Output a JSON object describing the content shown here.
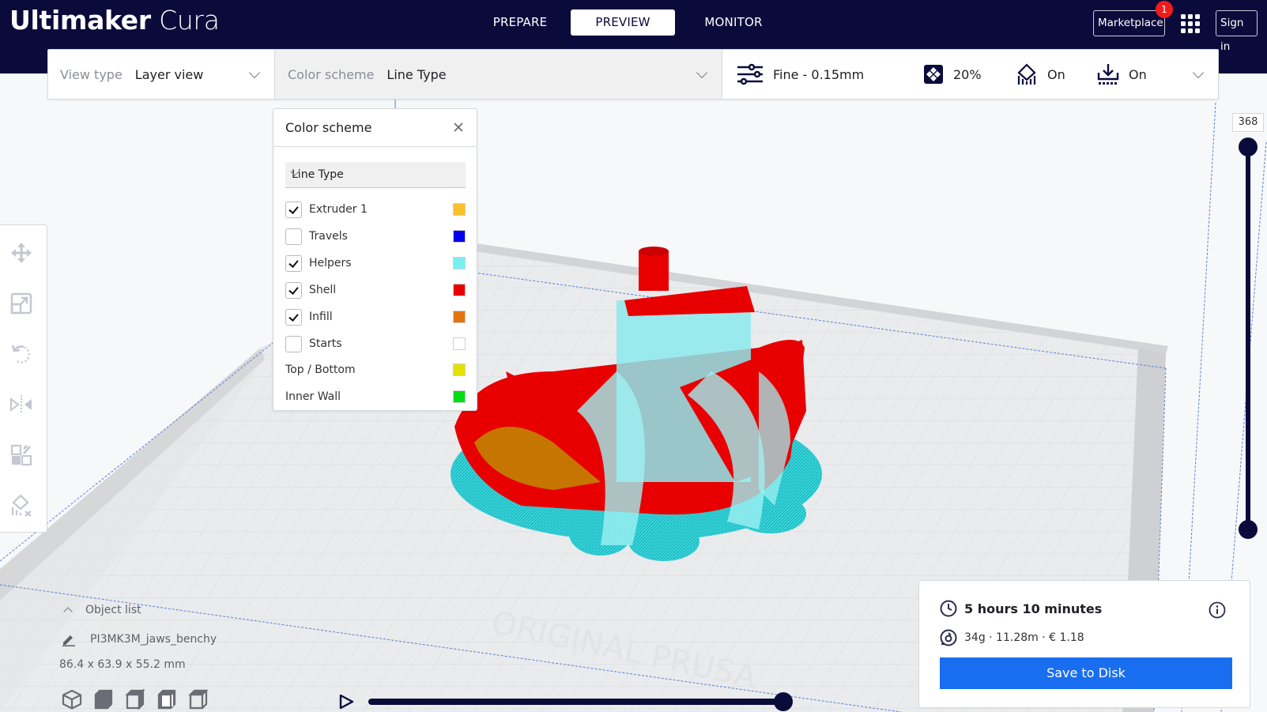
{
  "app": {
    "brand_bold": "Ultimaker",
    "brand_light": "Cura"
  },
  "header": {
    "stages": [
      {
        "label": "PREPARE",
        "active": false
      },
      {
        "label": "PREVIEW",
        "active": true
      },
      {
        "label": "MONITOR",
        "active": false
      }
    ],
    "marketplace_label": "Marketplace",
    "marketplace_badge": "1",
    "signin_label": "Sign in"
  },
  "toolbar": {
    "view_type_label": "View type",
    "view_type_value": "Layer view",
    "color_scheme_label": "Color scheme",
    "color_scheme_value": "Line Type",
    "profile": "Fine - 0.15mm",
    "infill": "20%",
    "support": "On",
    "adhesion": "On"
  },
  "color_scheme_panel": {
    "title": "Color scheme",
    "selected": "Line Type",
    "items": [
      {
        "label": "Extruder 1",
        "checkbox": true,
        "checked": true,
        "color": "#fbc02d"
      },
      {
        "label": "Travels",
        "checkbox": true,
        "checked": false,
        "color": "#0000ee"
      },
      {
        "label": "Helpers",
        "checkbox": true,
        "checked": true,
        "color": "#7aeff2"
      },
      {
        "label": "Shell",
        "checkbox": true,
        "checked": true,
        "color": "#e80000"
      },
      {
        "label": "Infill",
        "checkbox": true,
        "checked": true,
        "color": "#e57310"
      },
      {
        "label": "Starts",
        "checkbox": true,
        "checked": false,
        "color": "#ffffff"
      },
      {
        "label": "Top / Bottom",
        "checkbox": false,
        "checked": false,
        "color": "#e5e000"
      },
      {
        "label": "Inner Wall",
        "checkbox": false,
        "checked": false,
        "color": "#00dd11"
      }
    ]
  },
  "layer_slider": {
    "current_layer": "368",
    "upper_fraction": 1.0,
    "lower_fraction": 0.0
  },
  "path_slider": {
    "fraction": 1.0
  },
  "object_list": {
    "header": "Object list",
    "object_name": "PI3MK3M_jaws_benchy",
    "dimensions": "86.4 x 63.9 x 55.2 mm"
  },
  "print_summary": {
    "time": "5 hours 10 minutes",
    "material": "34g · 11.28m · € 1.18",
    "save_label": "Save to Disk"
  },
  "colors": {
    "header_bg": "#0b0b3b",
    "accent_blue": "#196ef0",
    "badge_red": "#f01c1c",
    "shell": "#e80000",
    "helpers": "#7aeff2"
  }
}
